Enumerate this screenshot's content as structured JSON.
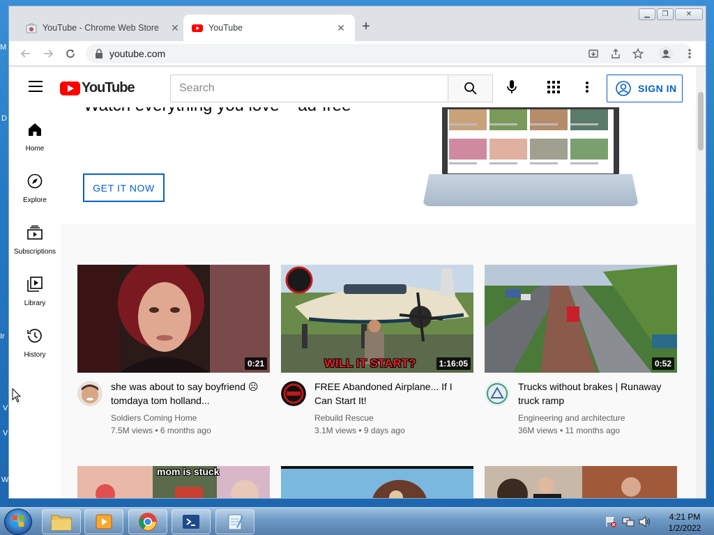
{
  "desktop": {
    "edge_letters": [
      "M",
      "D",
      "Ir",
      "V",
      "V",
      "W"
    ]
  },
  "browser": {
    "tabs": [
      {
        "title": "YouTube - Chrome Web Store",
        "active": false
      },
      {
        "title": "YouTube",
        "active": true
      }
    ],
    "new_tab_label": "+",
    "address": "youtube.com"
  },
  "youtube": {
    "logo_text": "YouTube",
    "search_placeholder": "Search",
    "sign_in_label": "SIGN IN",
    "guide": [
      {
        "label": "Home",
        "icon": "home-icon"
      },
      {
        "label": "Explore",
        "icon": "compass-icon"
      },
      {
        "label": "Subscriptions",
        "icon": "subscriptions-icon"
      },
      {
        "label": "Library",
        "icon": "library-icon"
      },
      {
        "label": "History",
        "icon": "history-icon"
      }
    ],
    "banner": {
      "headline": "Watch everything you love – ad-free",
      "cta_label": "GET IT NOW"
    },
    "videos": [
      {
        "title": "she was about to say boyfriend ☹ tomdaya tom holland...",
        "channel": "Soldiers Coming Home",
        "views": "7.5M views",
        "age": "6 months ago",
        "duration": "0:21"
      },
      {
        "title": "FREE Abandoned Airplane... If I Can Start It!",
        "channel": "Rebuild Rescue",
        "views": "3.1M views",
        "age": "9 days ago",
        "duration": "1:16:05",
        "thumb_caption": "WILL IT START?"
      },
      {
        "title": "Trucks without brakes | Runaway truck ramp",
        "channel": "Engineering and architecture",
        "views": "36M views",
        "age": "11 months ago",
        "duration": "0:52"
      },
      {
        "thumb_caption": "mom is stuck"
      }
    ],
    "meta_separator": " • "
  },
  "taskbar": {
    "time": "4:21 PM",
    "date": "1/2/2022"
  }
}
